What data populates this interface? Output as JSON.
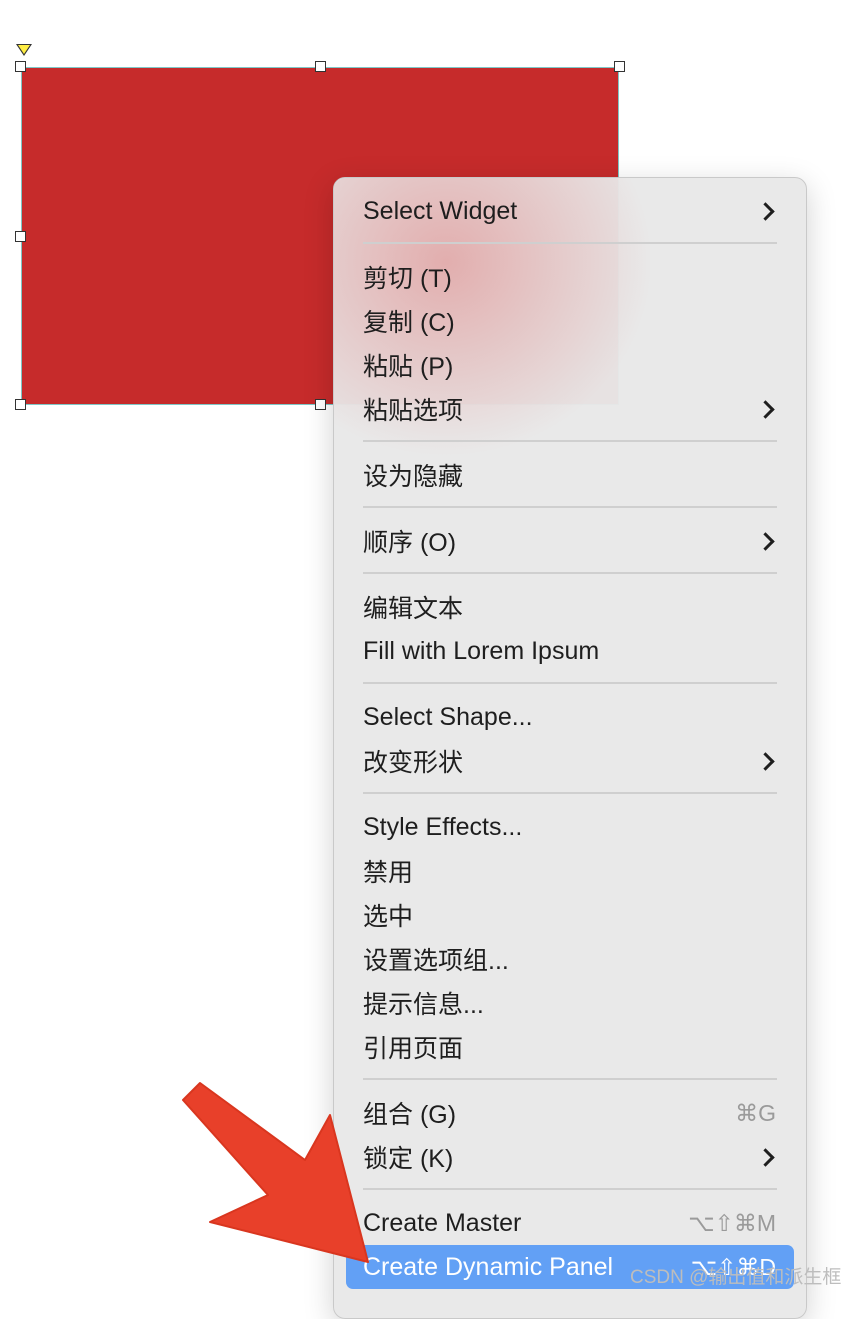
{
  "menu": {
    "items": [
      {
        "label": "Select Widget",
        "submenu": true
      },
      {
        "label": "剪切 (T)"
      },
      {
        "label": "复制 (C)"
      },
      {
        "label": "粘贴 (P)"
      },
      {
        "label": "粘贴选项",
        "submenu": true
      },
      {
        "label": "设为隐藏"
      },
      {
        "label": "顺序 (O)",
        "submenu": true
      },
      {
        "label": "编辑文本"
      },
      {
        "label": "Fill with Lorem Ipsum"
      },
      {
        "label": "Select Shape..."
      },
      {
        "label": "改变形状",
        "submenu": true
      },
      {
        "label": "Style Effects..."
      },
      {
        "label": "禁用"
      },
      {
        "label": "选中"
      },
      {
        "label": "设置选项组..."
      },
      {
        "label": "提示信息..."
      },
      {
        "label": "引用页面"
      },
      {
        "label": "组合 (G)",
        "shortcut": "⌘G"
      },
      {
        "label": "锁定 (K)",
        "submenu": true
      },
      {
        "label": "Create Master",
        "shortcut": "⌥⇧⌘M"
      },
      {
        "label": "Create Dynamic Panel",
        "shortcut": "⌥⇧⌘D",
        "highlighted": true
      }
    ]
  },
  "watermark": "CSDN @输出值和派生框",
  "colors": {
    "widget_fill": "#c62b2b",
    "highlight": "#62a0f5",
    "arrow": "#e8402a"
  }
}
